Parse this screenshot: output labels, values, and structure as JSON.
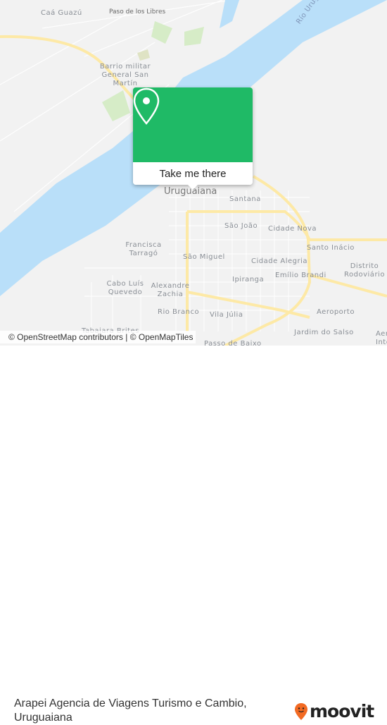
{
  "colors": {
    "water": "#b9dff9",
    "land": "#f2f2f2",
    "road": "#fde9a6",
    "park": "#d6ecc7",
    "popup": "#1fba66",
    "logo_orange": "#f26a23"
  },
  "map": {
    "places": [
      {
        "name": "Caá Guazú"
      },
      {
        "name": "Paso de los Libres"
      },
      {
        "name": "Barrio militar General San Martín"
      },
      {
        "name": "Uruguaiana"
      },
      {
        "name": "Santana"
      },
      {
        "name": "São João"
      },
      {
        "name": "Cidade Nova"
      },
      {
        "name": "Francisca Tarragó"
      },
      {
        "name": "São Miguel"
      },
      {
        "name": "Santo Inácio"
      },
      {
        "name": "Cidade Alegria"
      },
      {
        "name": "Distrito Rodoviário"
      },
      {
        "name": "Cabo Luís Quevedo"
      },
      {
        "name": "Alexandre Zachia"
      },
      {
        "name": "Ipiranga"
      },
      {
        "name": "Emílio Brandi"
      },
      {
        "name": "Rio Branco"
      },
      {
        "name": "Vila Júlia"
      },
      {
        "name": "Aeroporto"
      },
      {
        "name": "Tabajara Brites"
      },
      {
        "name": "Jardim do Salso"
      },
      {
        "name": "Passo de Baixo"
      },
      {
        "name": "Aeroporto Internacional"
      },
      {
        "name": "Río Uruguay"
      }
    ],
    "popup": {
      "button": "Take me there",
      "icon": "map-pin-icon"
    },
    "attribution": "© OpenStreetMap contributors | © OpenMapTiles"
  },
  "footer": {
    "title_line1": "Arapei Agencia de Viagens Turismo e Cambio,",
    "title_line2": "Uruguaiana",
    "logo": "moovit"
  }
}
